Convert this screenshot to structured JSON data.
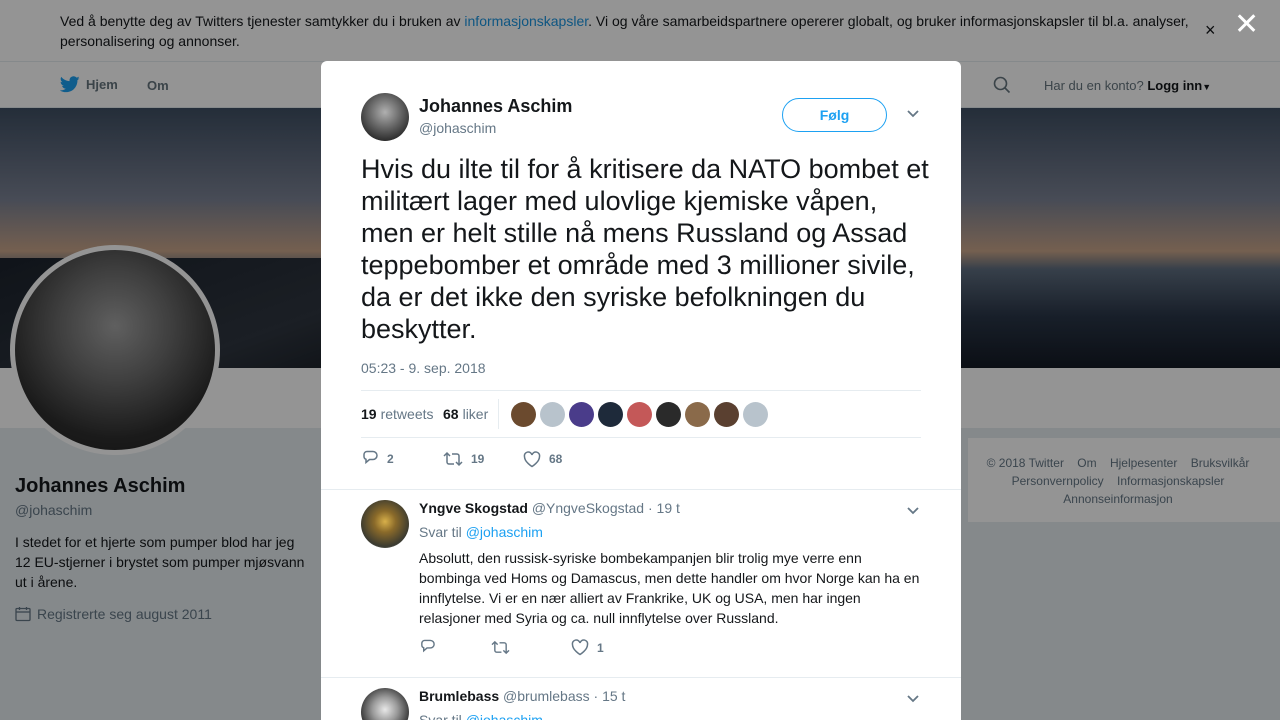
{
  "cookie_bar": {
    "text_before": "Ved å benytte deg av Twitters tjenester samtykker du i bruken av ",
    "link": "informasjonskapsler",
    "text_after": ". Vi og våre samarbeidspartnere opererer globalt, og bruker informasjonskapsler til bl.a. analyser, personalisering og annonser.",
    "close": "×"
  },
  "nav": {
    "home": "Hjem",
    "about": "Om",
    "account_question": "Har du en konto?",
    "login": "Logg inn"
  },
  "profile": {
    "name": "Johannes Aschim",
    "handle": "@johaschim",
    "bio": "I stedet for et hjerte som pumper blod har jeg 12 EU-stjerner i brystet som pumper mjøsvann ut i årene.",
    "joined": "Registrerte seg august 2011"
  },
  "footer": {
    "links": [
      "© 2018 Twitter",
      "Om",
      "Hjelpesenter",
      "Bruksvilkår",
      "Personvernpolicy",
      "Informasjonskapsler",
      "Annonseinformasjon"
    ]
  },
  "overlay": {
    "close": "✕"
  },
  "tweet": {
    "author_name": "Johannes Aschim",
    "author_handle": "@johaschim",
    "follow_label": "Følg",
    "text": "Hvis du ilte til for å kritisere da NATO bombet et militært lager med ulovlige kjemiske våpen, men er helt stille nå mens Russland og Assad teppebomber et område med 3 millioner sivile, da er det ikke den syriske befolkningen du beskytter.",
    "timestamp": "05:23 - 9. sep. 2018",
    "retweets_count": "19",
    "retweets_label": "retweets",
    "likes_count": "68",
    "likes_label": "liker",
    "liker_colors": [
      "#6b4a2e",
      "#b8c3cc",
      "#4a3c8a",
      "#1e2a3a",
      "#c45858",
      "#2a2a2a",
      "#8a6a4a",
      "#5a4030",
      "#b8c3cc"
    ],
    "actions": {
      "replies": "2",
      "retweets": "19",
      "likes": "68"
    }
  },
  "replies": [
    {
      "name": "Yngve Skogstad",
      "handle": "@YngveSkogstad",
      "time": "· 19 t",
      "reply_to_label": "Svar til",
      "reply_to_handle": "@johaschim",
      "text": "Absolutt, den russisk-syriske bombekampanjen blir trolig mye verre enn bombinga ved Homs og Damascus, men dette handler om hvor Norge kan ha en innflytelse. Vi er en nær alliert av Frankrike, UK og USA, men har ingen relasjoner med Syria og ca. null innflytelse over Russland.",
      "likes": "1"
    },
    {
      "name": "Brumlebass",
      "handle": "@brumlebass",
      "time": "· 15 t",
      "reply_to_label": "Svar til",
      "reply_to_handle": "@johaschim"
    }
  ]
}
